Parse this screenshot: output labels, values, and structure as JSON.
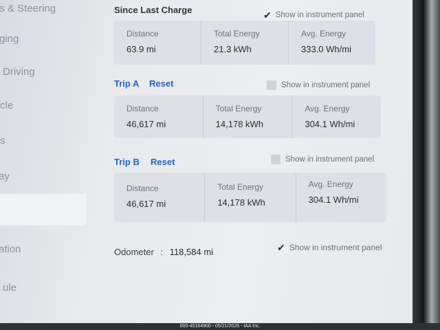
{
  "sidebar": {
    "items": [
      {
        "label": "ls & Steering"
      },
      {
        "label": "rging"
      },
      {
        "label": "Driving"
      },
      {
        "label": "cle"
      },
      {
        "label": "s"
      },
      {
        "label": "ay"
      },
      {
        "label": "ation"
      },
      {
        "label": "ule"
      }
    ]
  },
  "since_last_charge": {
    "title": "Since Last Charge",
    "show_label": "Show in instrument panel",
    "show_checked": true,
    "stats": [
      {
        "label": "Distance",
        "value": "63.9 mi"
      },
      {
        "label": "Total Energy",
        "value": "21.3 kWh"
      },
      {
        "label": "Avg. Energy",
        "value": "333.0 Wh/mi"
      }
    ]
  },
  "trip_a": {
    "title": "Trip A",
    "reset_label": "Reset",
    "show_label": "Show in instrument panel",
    "show_checked": false,
    "stats": [
      {
        "label": "Distance",
        "value": "46,617 mi"
      },
      {
        "label": "Total Energy",
        "value": "14,178 kWh"
      },
      {
        "label": "Avg. Energy",
        "value": "304.1 Wh/mi"
      }
    ]
  },
  "trip_b": {
    "title": "Trip B",
    "reset_label": "Reset",
    "show_label": "Show in instrument panel",
    "show_checked": false,
    "stats": [
      {
        "label": "Distance",
        "value": "46,617 mi"
      },
      {
        "label": "Total Energy",
        "value": "14,178 kWh"
      },
      {
        "label": "Avg. Energy",
        "value": "304.1 Wh/mi"
      }
    ]
  },
  "odometer": {
    "label": "Odometer",
    "separator": ":",
    "value": "118,584 mi",
    "show_label": "Show in instrument panel",
    "show_checked": true
  },
  "watermark": "000-45164900 - 05/21/2026 - IAA Inc.",
  "colors": {
    "accent": "#2563c9",
    "panel": "#dde0e5",
    "text": "#2a2e34"
  }
}
